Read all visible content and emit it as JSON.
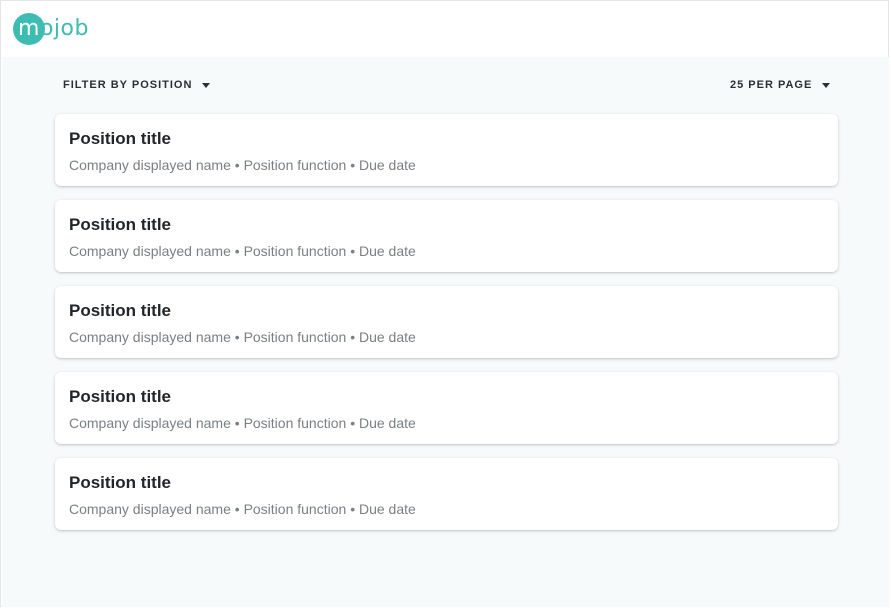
{
  "brand": {
    "logo_first": "m",
    "logo_rest": "ojob",
    "accent": "#3fbcb1"
  },
  "toolbar": {
    "filter_label": "FILTER BY POSITION",
    "filter_icon": "caret-down-icon",
    "per_page_label": "25 PER PAGE",
    "per_page_icon": "caret-down-icon"
  },
  "positions": [
    {
      "title": "Position title",
      "company": "Company displayed name",
      "function": "Position function",
      "due": "Due date",
      "separator": "•"
    },
    {
      "title": "Position title",
      "company": "Company displayed name",
      "function": "Position function",
      "due": "Due date",
      "separator": "•"
    },
    {
      "title": "Position title",
      "company": "Company displayed name",
      "function": "Position function",
      "due": "Due date",
      "separator": "•"
    },
    {
      "title": "Position title",
      "company": "Company displayed name",
      "function": "Position function",
      "due": "Due date",
      "separator": "•"
    },
    {
      "title": "Position title",
      "company": "Company displayed name",
      "function": "Position function",
      "due": "Due date",
      "separator": "•"
    }
  ]
}
